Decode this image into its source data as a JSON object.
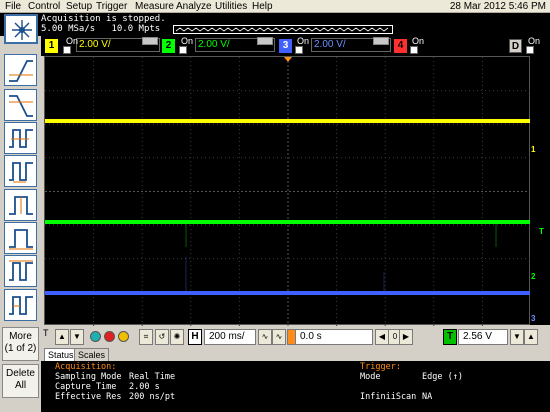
{
  "menu": {
    "items": [
      "File",
      "Control",
      "Setup",
      "Trigger",
      "Measure",
      "Analyze",
      "Utilities",
      "Help"
    ],
    "datetime": "28 Mar 2012  5:46 PM"
  },
  "status": {
    "line1": "Acquisition is stopped.",
    "line2": "5.00 MSa/s   10.0 Mpts"
  },
  "channels": [
    {
      "num": "1",
      "on_label": "On",
      "scale": "2.00 V/",
      "color": "#ffff00"
    },
    {
      "num": "2",
      "on_label": "On",
      "scale": "2.00 V/",
      "color": "#00ff00"
    },
    {
      "num": "3",
      "on_label": "On",
      "scale": "2.00 V/",
      "color": "#3f5fff"
    },
    {
      "num": "4",
      "on_label": "On",
      "color": "#ff3030"
    }
  ],
  "digital": {
    "label": "D",
    "on_label": "On"
  },
  "side_buttons": {
    "more": "More\n(1 of 2)",
    "delete": "Delete\nAll"
  },
  "controls": {
    "trig_small_label": "T",
    "h_label": "H",
    "timebase": "200 ms/",
    "delay": "0.0 s",
    "trig_box_label": "T",
    "trigger_level": "2.56 V"
  },
  "markers": {
    "ch1": "1",
    "trig": "T",
    "ch2": "2",
    "ch3": "3"
  },
  "tabs": [
    "Status",
    "Scales"
  ],
  "info": {
    "acq_header": "Acquisition:",
    "rows": [
      {
        "label": "Sampling Mode",
        "value": "Real Time"
      },
      {
        "label": "Capture Time",
        "value": "2.00 s"
      },
      {
        "label": "Effective Res",
        "value": "200 ns/pt"
      }
    ],
    "trigger_header": "Trigger:",
    "trigger_rows": [
      {
        "label": "Mode",
        "value": "Edge (↑)"
      },
      {
        "label": "InfiniiScan",
        "value": "NA"
      }
    ]
  },
  "colors": {
    "ch1": "#ffff00",
    "ch2": "#00ff00",
    "ch3": "#3f5fff",
    "ch4": "#ff3030",
    "acq_text": "#ff8c1a",
    "trigger_text": "#ff8c1a"
  }
}
